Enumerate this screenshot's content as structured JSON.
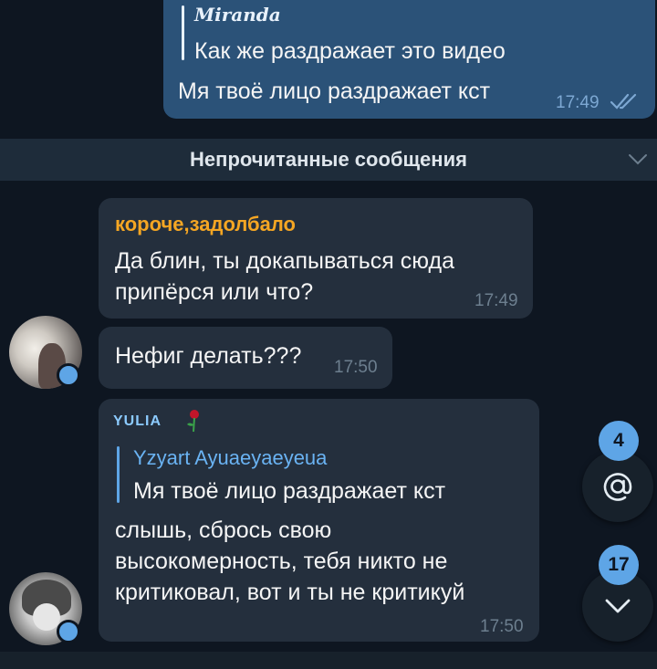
{
  "messages": {
    "m1": {
      "reply_name": "Miranda",
      "reply_text": "Как же раздражает это видео",
      "text": "Мя твоё лицо раздражает кст",
      "time": "17:49"
    },
    "unread_label": "Непрочитанные сообщения",
    "m2": {
      "sender": "короче,задолбало",
      "line1": "Да блин, ты докапываться сюда",
      "line2": "припёрся или что?",
      "time": "17:49"
    },
    "m3": {
      "text": "Нефиг делать???",
      "time": "17:50"
    },
    "m4": {
      "sender": "YULIA",
      "reply_name": "Yzyart Ayuaeyaeyeua",
      "reply_text": "Мя твоё лицо раздражает кст",
      "line1": "слышь, сбрось свою",
      "line2": "высокомерность, тебя никто не",
      "line3": "критиковал, вот и ты не критикуй",
      "time": "17:50"
    }
  },
  "fabs": {
    "mentions_count": "4",
    "unread_count": "17"
  },
  "colors": {
    "background": "#0e1621",
    "incoming_bubble": "#242f3d",
    "outgoing_bubble": "#2b5278",
    "accent": "#5ea5e6",
    "sender_orange": "#f5a623"
  },
  "icons": {
    "read_checks": "double-check-icon",
    "mention": "at-icon",
    "scroll_down": "chevron-down-icon",
    "sender_badge": "rose-icon"
  }
}
